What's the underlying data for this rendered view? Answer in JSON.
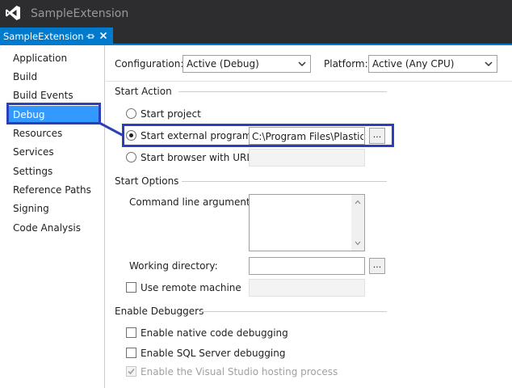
{
  "window": {
    "title": "SampleExtension"
  },
  "tab": {
    "label": "SampleExtension"
  },
  "nav": {
    "items": [
      {
        "label": "Application",
        "selected": false
      },
      {
        "label": "Build",
        "selected": false
      },
      {
        "label": "Build Events",
        "selected": false
      },
      {
        "label": "Debug",
        "selected": true
      },
      {
        "label": "Resources",
        "selected": false
      },
      {
        "label": "Services",
        "selected": false
      },
      {
        "label": "Settings",
        "selected": false
      },
      {
        "label": "Reference Paths",
        "selected": false
      },
      {
        "label": "Signing",
        "selected": false
      },
      {
        "label": "Code Analysis",
        "selected": false
      }
    ]
  },
  "config": {
    "configuration_label": "Configuration:",
    "configuration_value": "Active (Debug)",
    "platform_label": "Platform:",
    "platform_value": "Active (Any CPU)"
  },
  "start_action": {
    "header": "Start Action",
    "start_project": "Start project",
    "start_external": "Start external program:",
    "external_path": "C:\\Program Files\\PlasticSCM",
    "start_browser": "Start browser with URL:",
    "browser_url": "",
    "browse_label": "..."
  },
  "start_options": {
    "header": "Start Options",
    "command_line_label": "Command line arguments:",
    "command_line_value": "",
    "working_dir_label": "Working directory:",
    "working_dir_value": "",
    "browse_label": "...",
    "remote_label": "Use remote machine",
    "remote_value": ""
  },
  "debuggers": {
    "header": "Enable Debuggers",
    "native": "Enable native code debugging",
    "sql": "Enable SQL Server debugging",
    "hosting": "Enable the Visual Studio hosting process"
  },
  "colors": {
    "titlebar": "#2d2d30",
    "accent": "#007acc",
    "selection": "#3399ff",
    "callout": "#2a3fb8"
  }
}
